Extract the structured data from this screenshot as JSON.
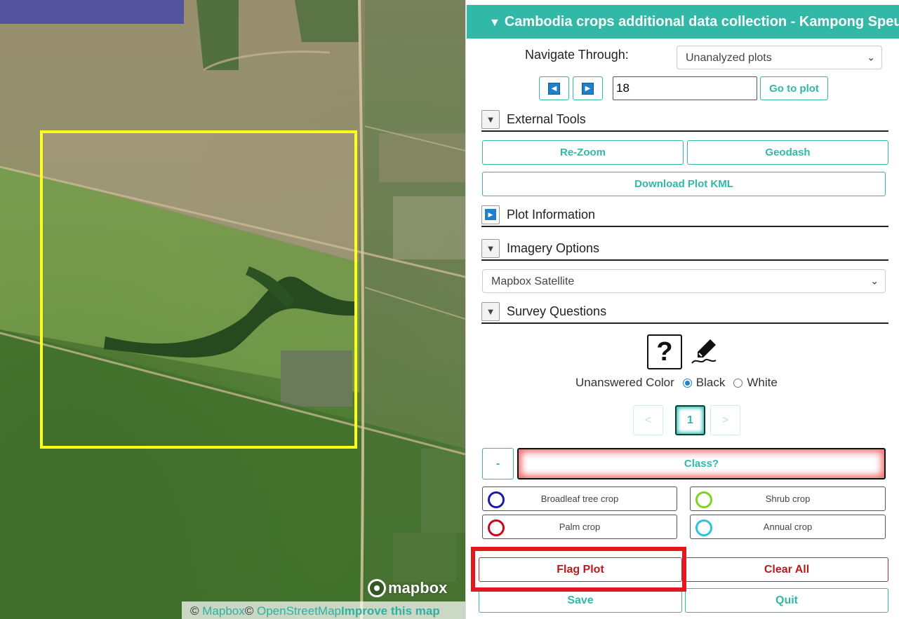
{
  "map": {
    "attribution": {
      "copyright1": "© ",
      "mapbox_link": "Mapbox",
      "copyright2": "© ",
      "osm_link": "OpenStreetMap",
      "improve": "Improve this map"
    },
    "logo_text": "mapbox",
    "plot_outline_color": "#ffff1a"
  },
  "panel": {
    "header": {
      "caret": "▼",
      "title": "Cambodia crops additional data collection - Kampong Speu"
    },
    "navigate": {
      "label": "Navigate Through:",
      "selected": "Unanalyzed plots",
      "prev_icon": "◀",
      "next_icon": "▶",
      "plot_number": "18",
      "go_label": "Go to plot"
    },
    "sections": {
      "external_tools": {
        "toggle": "▼",
        "title": "External Tools"
      },
      "plot_info": {
        "toggle": "▶",
        "title": "Plot Information"
      },
      "imagery": {
        "toggle": "▼",
        "title": "Imagery Options"
      },
      "survey": {
        "toggle": "▼",
        "title": "Survey Questions"
      }
    },
    "tools": {
      "rezoom": "Re-Zoom",
      "geodash": "Geodash",
      "download_kml": "Download Plot KML"
    },
    "imagery_selected": "Mapbox Satellite",
    "survey": {
      "help_icon": "?",
      "unanswered_label": "Unanswered Color",
      "black": "Black",
      "white": "White",
      "pages": {
        "prev": "<",
        "current": "1",
        "next": ">"
      },
      "collapse_label": "-",
      "question": "Class?",
      "answers": [
        {
          "label": "Broadleaf tree crop",
          "color": "#1a1aa8"
        },
        {
          "label": "Shrub crop",
          "color": "#7ed321"
        },
        {
          "label": "Palm crop",
          "color": "#d0021b"
        },
        {
          "label": "Annual crop",
          "color": "#29c3e0"
        }
      ]
    },
    "actions": {
      "flag": "Flag Plot",
      "clear": "Clear All",
      "save": "Save",
      "quit": "Quit"
    },
    "colors": {
      "accent": "#31b8a7",
      "danger": "#b71c1c",
      "highlight": "#e3171f"
    }
  }
}
